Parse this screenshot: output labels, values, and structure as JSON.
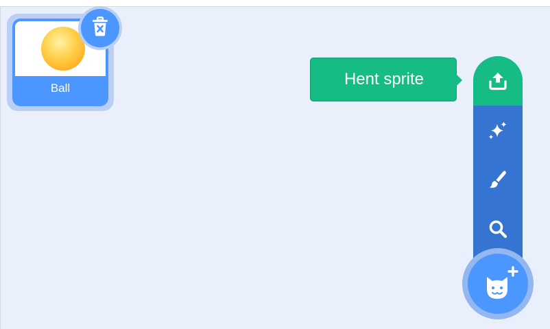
{
  "sprite": {
    "name": "Ball",
    "selected": true
  },
  "tooltip": {
    "text": "Hent sprite"
  },
  "flyout": {
    "items": [
      {
        "icon": "upload-icon",
        "active": true
      },
      {
        "icon": "sparkle-icon",
        "active": false
      },
      {
        "icon": "paintbrush-icon",
        "active": false
      },
      {
        "icon": "search-icon",
        "active": false
      }
    ]
  },
  "main_button": {
    "icon": "cat-plus-icon"
  },
  "colors": {
    "background": "#e9f0fb",
    "sprite_blue": "#4c97ff",
    "flyout_blue": "#3674d1",
    "tooltip_green": "#15bd84"
  }
}
